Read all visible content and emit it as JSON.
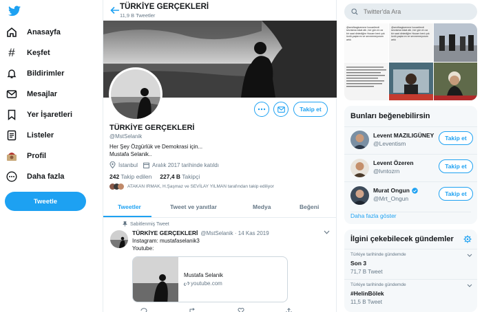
{
  "nav": {
    "items": [
      {
        "label": "Anasayfa"
      },
      {
        "label": "Keşfet"
      },
      {
        "label": "Bildirimler"
      },
      {
        "label": "Mesajlar"
      },
      {
        "label": "Yer İşaretleri"
      },
      {
        "label": "Listeler"
      },
      {
        "label": "Profil"
      },
      {
        "label": "Daha fazla"
      }
    ],
    "tweet_button": "Tweetle"
  },
  "header": {
    "name": "TÜRKİYE GERÇEKLERİ",
    "tweet_count": "11,9 B Tweetler"
  },
  "profile": {
    "name": "TÜRKİYE GERÇEKLERİ",
    "handle": "@MstSelanik",
    "bio_line1": "Her Şey Özgürlük ve Demokrasi için...",
    "bio_line2": "Mustafa Selanik..",
    "location": "İstanbul",
    "joined": "Aralık 2017 tarihinde katıldı",
    "following_count": "242",
    "following_label": "Takip edilen",
    "followers_count": "227,4 B",
    "followers_label": "Takipçi",
    "followed_by": "ATAKAN IRMAK, H.Şaşmaz ve SEVİLAY YILMAN tarafından takip ediliyor",
    "follow_button": "Takip et",
    "more_icon": "ellipsis-icon",
    "message_icon": "envelope-icon"
  },
  "tabs": [
    {
      "label": "Tweetler",
      "active": true
    },
    {
      "label": "Tweet ve yanıtlar",
      "active": false
    },
    {
      "label": "Medya",
      "active": false
    },
    {
      "label": "Beğeni",
      "active": false
    }
  ],
  "pinned_tweet": {
    "pinned_label": "Sabitlenmiş Tweet",
    "author": "TÜRKİYE GERÇEKLERİ",
    "handle_date": "@MstSelanik · 14 Kas 2019",
    "line1": "Instagram: mustafaselanik3",
    "line2": "Youtube:",
    "card_title": "Mustafa Selanik",
    "card_link": "youtube.com"
  },
  "search": {
    "placeholder": "Twitter'da Ara"
  },
  "media_grid": {
    "tile1_text": "@sevilkagluemme hocaefendi sevdama tokat attı ,her gün en az bir saat dinlediğim Hocam beni çok üzdü,paşkırım ve sevmemeyorum artık",
    "tile2_text": "@sevilkagluemme hocaefendi sevdama tokat attı ,her gün en az bir saat dinlediğim Hocam beni çok üzdü,paşkırım ve sevmemeyorum artık"
  },
  "who_to_follow": {
    "title": "Bunları beğenebilirsin",
    "users": [
      {
        "name": "Levent MAZILIGÜNEY",
        "handle": "@Leventism",
        "button": "Takip et"
      },
      {
        "name": "Levent Özeren",
        "handle": "@lvntozrn",
        "button": "Takip et"
      },
      {
        "name": "Murat Ongun",
        "handle": "@Mrt_Ongun",
        "button": "Takip et"
      }
    ],
    "show_more": "Daha fazla göster"
  },
  "trends": {
    "title": "İlgini çekebilecek gündemler",
    "items": [
      {
        "context": "Türkiye tarihinde gündemde",
        "name": "Son 3",
        "count": "71,7 B Tweet"
      },
      {
        "context": "Türkiye tarihinde gündemde",
        "name": "#HelinBölek",
        "count": "11,5 B Tweet"
      }
    ]
  },
  "colors": {
    "accent": "#1da1f2",
    "muted": "#657786",
    "background_panel": "#f5f8fa",
    "border": "#e6ecf0"
  }
}
